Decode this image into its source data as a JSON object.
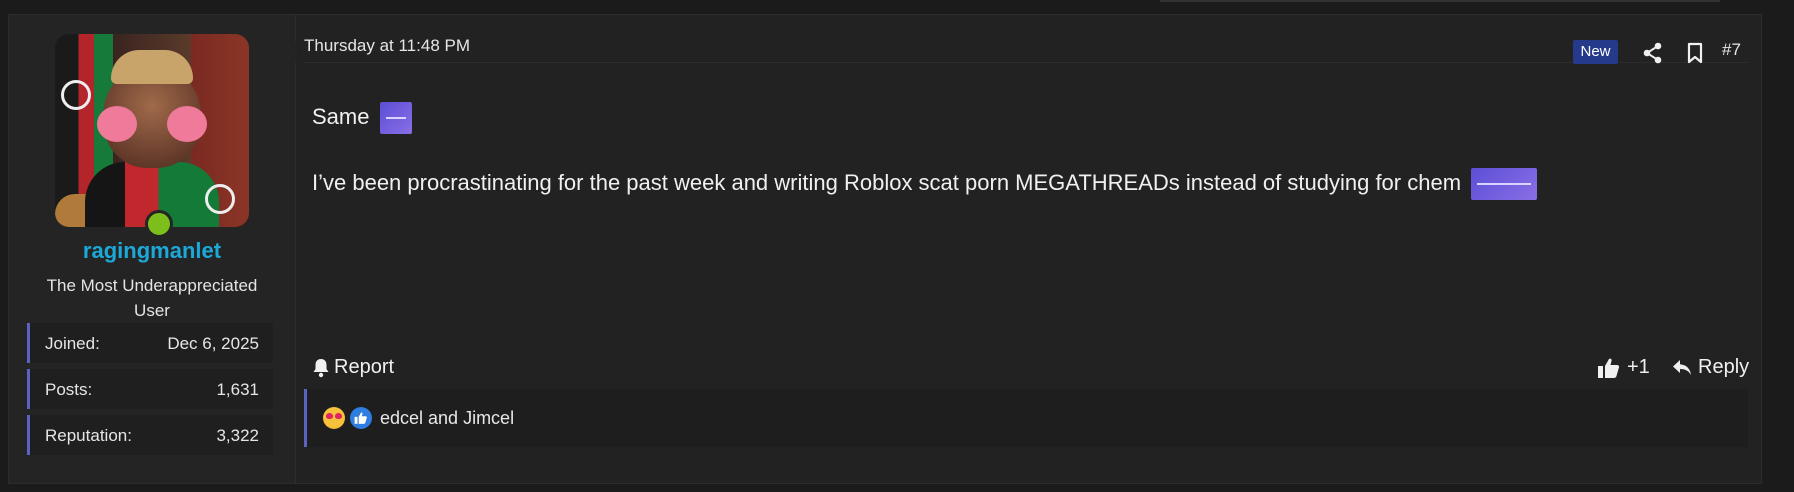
{
  "user": {
    "username": "ragingmanlet",
    "title": "The Most Underappreciated User",
    "online": true,
    "stats": [
      {
        "label": "Joined:",
        "value": "Dec 6, 2025"
      },
      {
        "label": "Posts:",
        "value": "1,631"
      },
      {
        "label": "Reputation:",
        "value": "3,322"
      }
    ]
  },
  "post": {
    "timestamp": "Thursday at 11:48 PM",
    "badge": "New",
    "number": "#7",
    "lines": [
      "Same",
      "I’ve been procrastinating for the past week and writing Roblox scat porn MEGATHREADs instead of studying for chem"
    ]
  },
  "actions": {
    "report": "Report",
    "like": "+1",
    "reply": "Reply"
  },
  "reactions": {
    "users": "edcel and Jimcel",
    "types": [
      "star-struck",
      "like"
    ]
  },
  "colors": {
    "accent": "#5a63c2",
    "username": "#1ca8d8",
    "badge": "#253a8a",
    "online": "#7cbf1c"
  }
}
